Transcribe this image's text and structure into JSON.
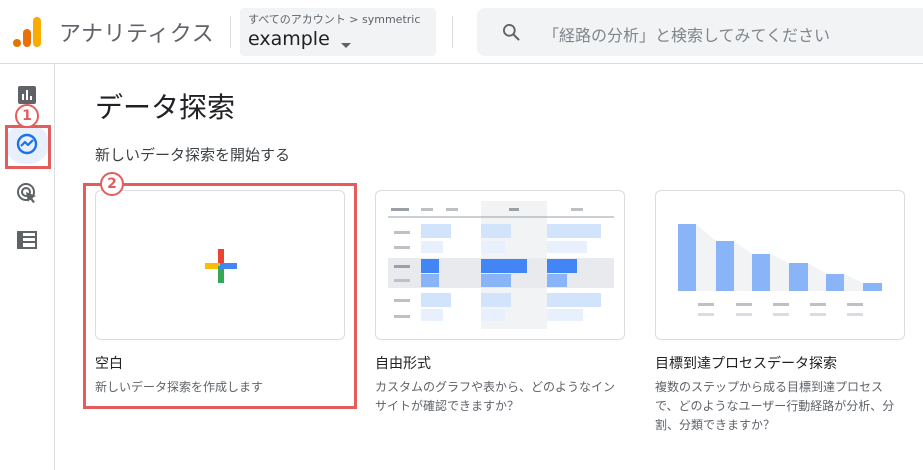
{
  "header": {
    "app_title": "アナリティクス",
    "account_path": "すべてのアカウント > symmetric",
    "property_name": "example",
    "search_placeholder": "「経路の分析」と検索してみてください"
  },
  "nav": {
    "items": [
      {
        "icon": "reports-icon"
      },
      {
        "icon": "explore-icon",
        "active": true
      },
      {
        "icon": "advertising-icon"
      },
      {
        "icon": "configure-icon"
      }
    ]
  },
  "annotations": {
    "badge_1": "1",
    "badge_2": "2",
    "color": "#e35d5d"
  },
  "main": {
    "title": "データ探索",
    "subtitle": "新しいデータ探索を開始する",
    "templates": [
      {
        "name": "空白",
        "description": "新しいデータ探索を作成します"
      },
      {
        "name": "自由形式",
        "description": "カスタムのグラフや表から、どのようなインサイトが確認できますか？"
      },
      {
        "name": "目標到達プロセスデータ探索",
        "description": "複数のステップから成る目標到達プロセスで、どのようなユーザー行動経路が分析、分割、分類できますか？"
      }
    ]
  },
  "colors": {
    "accent_blue": "#1a73e8",
    "light_blue": "#8ab4f8",
    "plus_red": "#ea4335",
    "plus_yellow": "#fbbc04",
    "plus_green": "#34a853",
    "plus_blue": "#4285f4"
  }
}
